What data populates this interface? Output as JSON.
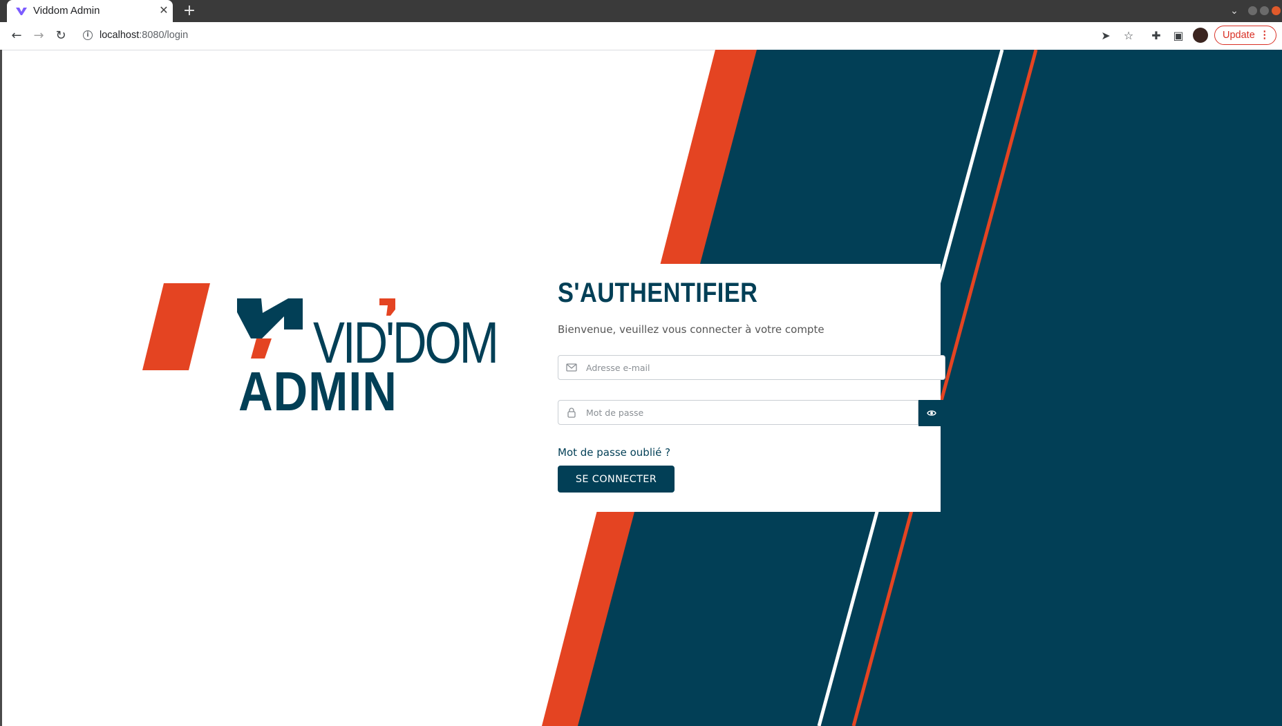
{
  "browser": {
    "tab_title": "Viddom Admin",
    "new_tab_label": "+",
    "url_host": "localhost",
    "url_rest": ":8080/login",
    "update_label": "Update"
  },
  "brand": {
    "wordmark": "VID'DOM",
    "subtitle": "ADMIN",
    "primary_color": "#023f56",
    "accent_color": "#e44422"
  },
  "login": {
    "title": "S'AUTHENTIFIER",
    "subtitle": "Bienvenue, veuillez vous connecter à votre compte",
    "email_placeholder": "Adresse e-mail",
    "password_placeholder": "Mot de passe",
    "forgot_label": "Mot de passe oublié ?",
    "submit_label": "SE CONNECTER"
  }
}
